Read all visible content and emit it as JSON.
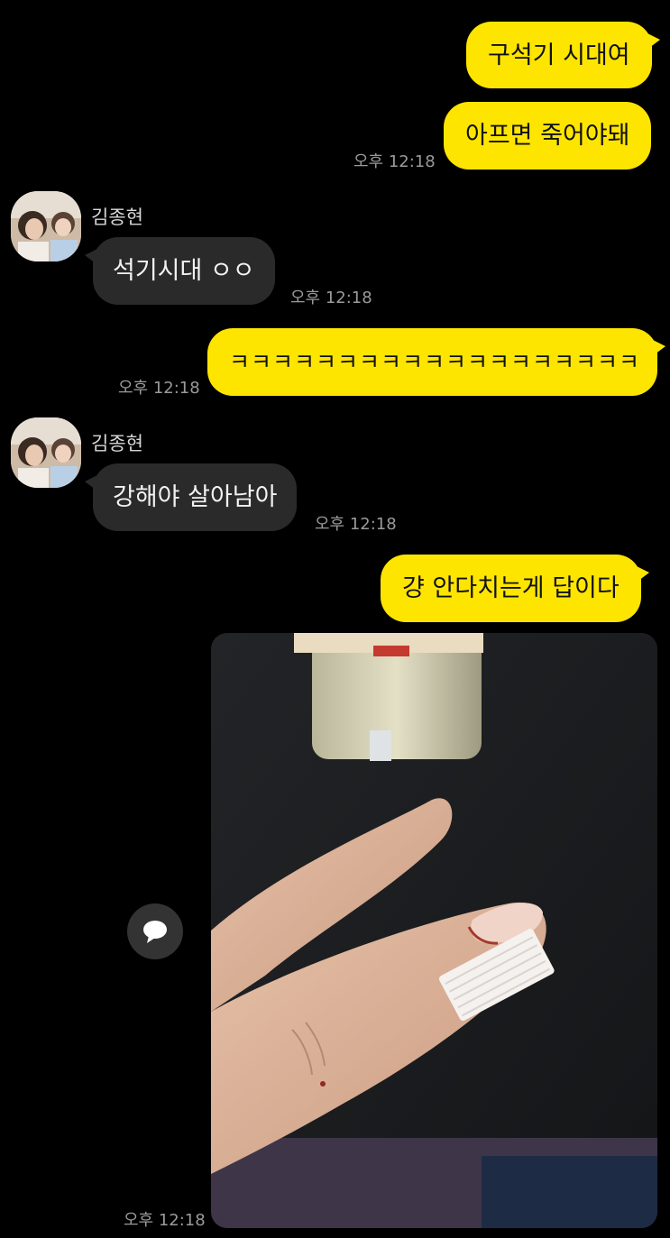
{
  "chat": {
    "messages": [
      {
        "sender": "me",
        "text": "구석기 시대여"
      },
      {
        "sender": "me",
        "text": "아프면 죽어야돼",
        "time": "오후 12:18"
      },
      {
        "sender": "other",
        "name": "김종현",
        "text": "석기시대 ㅇㅇ",
        "time": "오후 12:18"
      },
      {
        "sender": "me",
        "text": "ㅋㅋㅋㅋㅋㅋㅋㅋㅋㅋㅋㅋㅋㅋㅋㅋㅋㅋㅋ",
        "time": "오후 12:18"
      },
      {
        "sender": "other",
        "name": "김종현",
        "text": "강해야 살아남아",
        "time": "오후 12:18"
      },
      {
        "sender": "me",
        "text": "걍 안다치는게 답이다"
      },
      {
        "sender": "me",
        "type": "photo",
        "time": "오후 12:18"
      }
    ]
  },
  "colors": {
    "background": "#000000",
    "my_bubble": "#fee500",
    "other_bubble": "#2a2a2a",
    "timestamp": "#9a9a9a"
  },
  "icons": {
    "share": "speech-bubble-icon",
    "avatar": "profile-photo-icon"
  }
}
